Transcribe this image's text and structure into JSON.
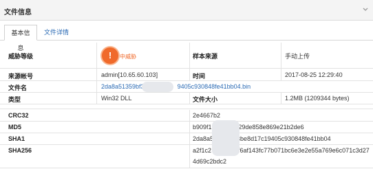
{
  "header": {
    "title": "文件信息"
  },
  "tabs": [
    {
      "label": "基本信息"
    },
    {
      "label": "文件详情"
    }
  ],
  "basic": {
    "threat_level_label": "威胁等级",
    "threat_level_value": "中威胁",
    "sample_source_label": "样本来源",
    "sample_source_value": "手动上传",
    "source_account_label": "来源帐号",
    "source_account_value": "admin[10.65.60.103]",
    "time_label": "时间",
    "time_value": "2017-08-25 12:29:40",
    "filename_label": "文件名",
    "filename_value_a": "2da8a51359bf3",
    "filename_value_b": "9405c930848fe41bb04.bin",
    "type_label": "类型",
    "type_value": "Win32 DLL",
    "size_label": "文件大小",
    "size_value": "1.2MB (1209344 bytes)"
  },
  "hashes": {
    "crc32_label": "CRC32",
    "crc32_value": "2e4667b2",
    "md5_label": "MD5",
    "md5_value_a": "b909f1",
    "md5_value_b": "e29de858e869e21b2de6",
    "sha1_label": "SHA1",
    "sha1_value_a": "2da8a5",
    "sha1_value_b": "3be8d17c19405c930848fe41bb04",
    "sha256_label": "SHA256",
    "sha256_value_a": "a2f1c2",
    "sha256_value_b": "5f6af143fc77b071bc6e3e2e55a769e6c071c3d27",
    "sha256_value_c": "4d69c2bdc2"
  },
  "colors": {
    "accent_link": "#2a6ab4",
    "threat_orange": "#f06a2b"
  }
}
